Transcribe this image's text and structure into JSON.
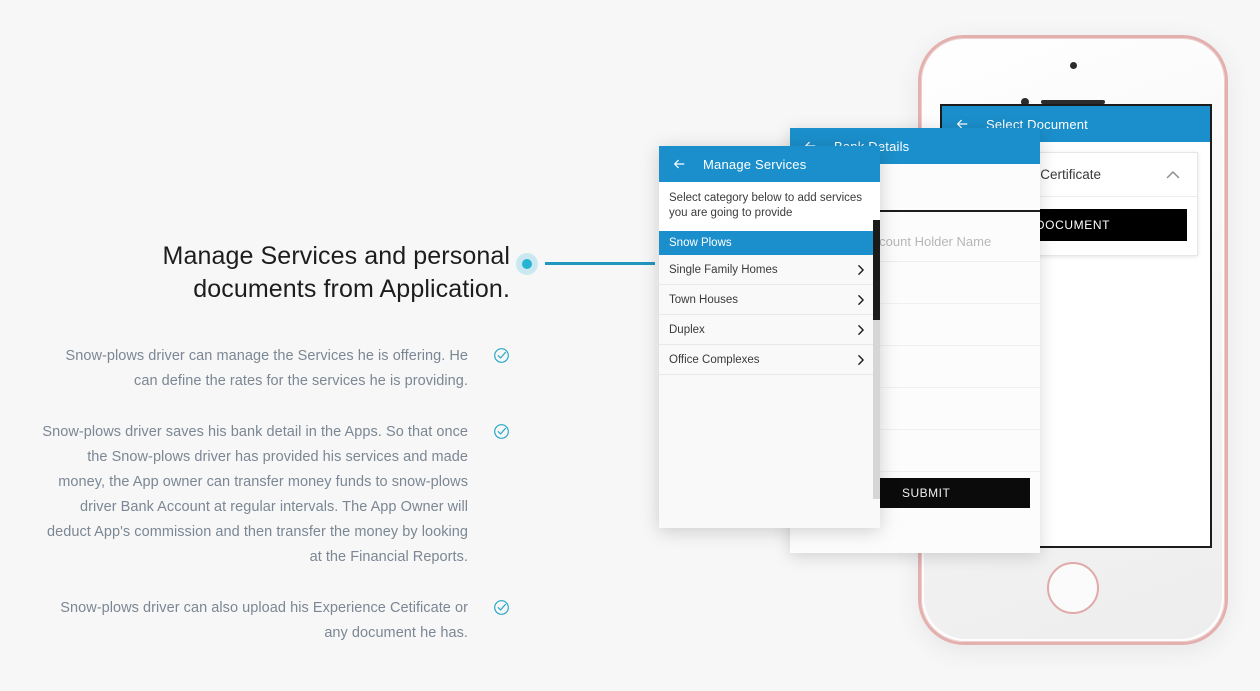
{
  "theme": {
    "page_bg": "#f7f7f7",
    "accent_blue": "#1b8fcb",
    "accent_teal": "#27b3d4",
    "connector_line": "#2196bf",
    "phone_frame": "#e3b0ae",
    "button_black": "#000000",
    "body_text": "#7b8794",
    "heading_text": "#1d1d1d"
  },
  "copy": {
    "headline_line1": "Manage Services and personal",
    "headline_line2": "documents from Application.",
    "bullets": [
      {
        "text": "Snow-plows driver can manage the Services he is offering. He can define the rates for the services he is providing.",
        "icon": "check-circle-icon"
      },
      {
        "text": "Snow-plows driver saves his bank detail in the Apps. So that once the Snow-plows driver has provided his services and made money, the App owner can transfer money funds to snow-plows driver Bank Account at regular intervals. The App Owner will deduct App's commission and then transfer the money by looking at the Financial Reports.",
        "icon": "check-circle-icon"
      },
      {
        "text": "Snow-plows driver can also upload his Experience Cetificate or any document he has.",
        "icon": "check-circle-icon"
      }
    ]
  },
  "connector": {
    "dot_name": "connector-dot",
    "line_name": "connector-line"
  },
  "phone": {
    "device": "iphone-rose-gold",
    "camera": "front-camera",
    "speaker": "earpiece-speaker",
    "sensor": "proximity-sensor",
    "home_button": "home-button"
  },
  "screen_select_document": {
    "appbar": {
      "back_icon": "back-arrow-icon",
      "title": "Select Document"
    },
    "dropdown": {
      "label": "Experience Certificate",
      "chevron_icon": "chevron-up-icon"
    },
    "upload_button_label": "UPLOAD DOCUMENT"
  },
  "card_bank_details": {
    "appbar": {
      "back_icon": "back-arrow-icon",
      "title": "Bank Details"
    },
    "fields": [
      {
        "placeholder": "Account Holder Name"
      }
    ],
    "submit_label": "SUBMIT"
  },
  "card_manage_services": {
    "appbar": {
      "back_icon": "back-arrow-icon",
      "title": "Manage Services"
    },
    "hint": "Select category below to add services you are going to provide",
    "selected_category": "Snow Plows",
    "items": [
      {
        "label": "Single Family Homes",
        "chevron_icon": "chevron-right-icon"
      },
      {
        "label": "Town Houses",
        "chevron_icon": "chevron-right-icon"
      },
      {
        "label": "Duplex",
        "chevron_icon": "chevron-right-icon"
      },
      {
        "label": "Office Complexes",
        "chevron_icon": "chevron-right-icon"
      }
    ],
    "scrollbar": "vertical-scrollbar"
  }
}
